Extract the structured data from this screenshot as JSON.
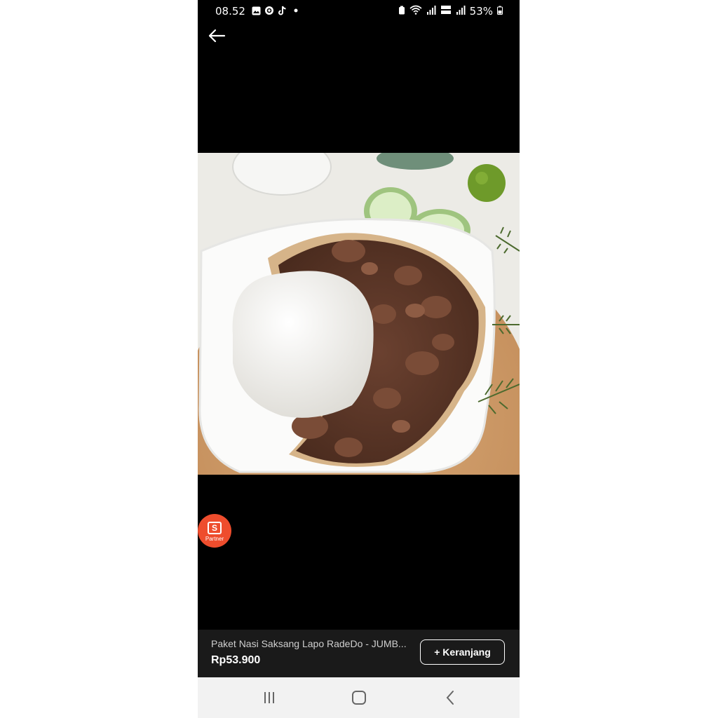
{
  "status_bar": {
    "time": "08.52",
    "left_icons": [
      "gallery-icon",
      "threads-icon",
      "tiktok-icon",
      "notification-dot-icon"
    ],
    "right_icons": [
      "battery-saver-icon",
      "wifi-icon",
      "signal-icon",
      "volte-icon",
      "signal-icon"
    ],
    "battery": "53%"
  },
  "product": {
    "image_alt": "Paket Nasi Saksang Lapo RadeDo - JUMBO",
    "title": "Paket Nasi Saksang Lapo RadeDo - JUMB...",
    "price": "Rp53.900",
    "add_to_cart_label": "+ Keranjang"
  },
  "partner_badge": {
    "label": "Partner",
    "icon_letter": "S"
  },
  "nav": {
    "icons": [
      "recents-icon",
      "home-icon",
      "back-icon"
    ]
  },
  "colors": {
    "partner_orange": "#ee4d2d",
    "background": "#000000",
    "nav_background": "#f2f2f2"
  }
}
